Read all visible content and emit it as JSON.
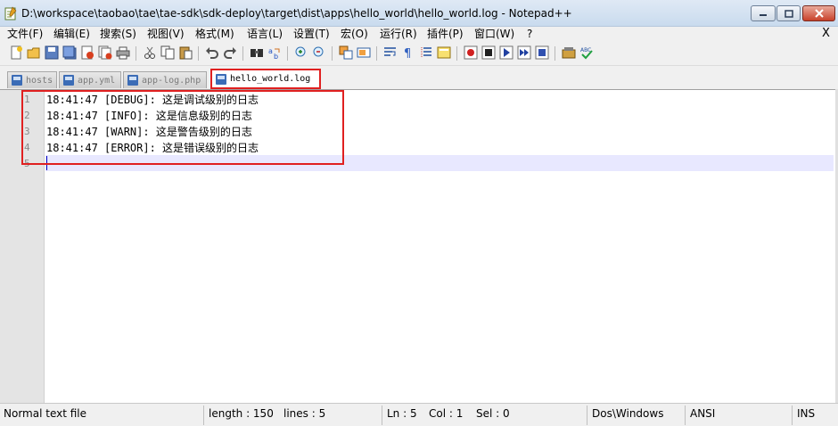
{
  "window": {
    "title": "D:\\workspace\\taobao\\tae\\tae-sdk\\sdk-deploy\\target\\dist\\apps\\hello_world\\hello_world.log - Notepad++"
  },
  "menu": {
    "items": [
      "文件(F)",
      "编辑(E)",
      "搜索(S)",
      "视图(V)",
      "格式(M)",
      "语言(L)",
      "设置(T)",
      "宏(O)",
      "运行(R)",
      "插件(P)",
      "窗口(W)",
      "?"
    ],
    "close_x": "X"
  },
  "toolbar": {
    "icons": [
      "new-file-icon",
      "open-file-icon",
      "save-icon",
      "save-all-icon",
      "close-icon",
      "close-all-icon",
      "print-icon",
      "cut-icon",
      "copy-icon",
      "paste-icon",
      "undo-icon",
      "redo-icon",
      "find-icon",
      "replace-icon",
      "zoom-in-icon",
      "zoom-out-icon",
      "sync-vertical-icon",
      "sync-horizontal-icon",
      "word-wrap-icon",
      "show-all-chars-icon",
      "indent-guide-icon",
      "user-lang-icon",
      "record-macro-icon",
      "stop-record-icon",
      "play-macro-icon",
      "run-macro-multiple-icon",
      "save-macro-icon",
      "plugin-icon",
      "spell-check-icon"
    ]
  },
  "tabs": [
    {
      "label": "hosts",
      "active": false
    },
    {
      "label": "app.yml",
      "active": false
    },
    {
      "label": "app-log.php",
      "active": false
    },
    {
      "label": "hello_world.log",
      "active": true
    }
  ],
  "editor": {
    "line_numbers": [
      "1",
      "2",
      "3",
      "4",
      "5"
    ],
    "lines": [
      "18:41:47 [DEBUG]: 这是调试级别的日志",
      "18:41:47 [INFO]: 这是信息级别的日志",
      "18:41:47 [WARN]: 这是警告级别的日志",
      "18:41:47 [ERROR]: 这是错误级别的日志",
      ""
    ]
  },
  "status": {
    "file_type": "Normal text file",
    "length": "length : 150",
    "lines": "lines : 5",
    "ln": "Ln : 5",
    "col": "Col : 1",
    "sel": "Sel : 0",
    "eol": "Dos\\Windows",
    "encoding": "ANSI",
    "mode": "INS"
  },
  "colors": {
    "highlight_border": "#e02020",
    "current_line": "#e8e8ff"
  }
}
